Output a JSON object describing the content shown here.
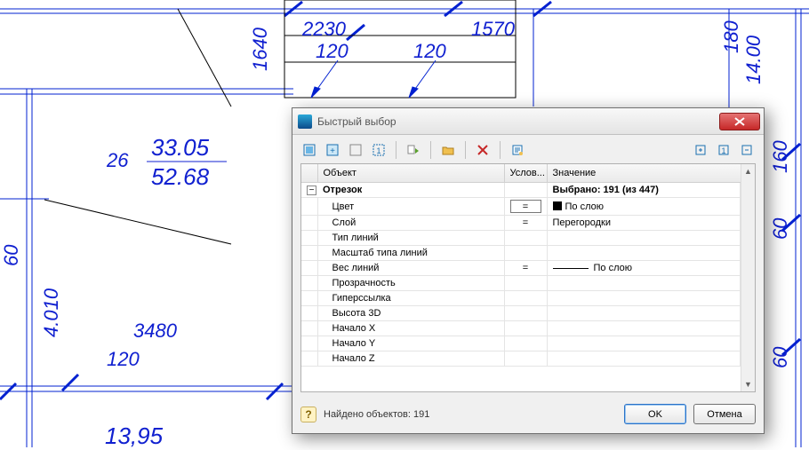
{
  "dialog": {
    "title": "Быстрый выбор",
    "headers": {
      "object": "Объект",
      "condition": "Услов...",
      "value": "Значение"
    },
    "group": {
      "name": "Отрезок",
      "summary": "Выбрано: 191 (из 447)"
    },
    "rows": [
      {
        "prop": "Цвет",
        "cond": "=",
        "value": "По слою",
        "swatch": true
      },
      {
        "prop": "Слой",
        "cond": "=",
        "value": "Перегородки"
      },
      {
        "prop": "Тип линий",
        "cond": "",
        "value": ""
      },
      {
        "prop": "Масштаб типа линий",
        "cond": "",
        "value": ""
      },
      {
        "prop": "Вес линий",
        "cond": "=",
        "value": "По слою",
        "lineweight": true
      },
      {
        "prop": "Прозрачность",
        "cond": "",
        "value": ""
      },
      {
        "prop": "Гиперссылка",
        "cond": "",
        "value": ""
      },
      {
        "prop": "Высота 3D",
        "cond": "",
        "value": ""
      },
      {
        "prop": "Начало X",
        "cond": "",
        "value": ""
      },
      {
        "prop": "Начало Y",
        "cond": "",
        "value": ""
      },
      {
        "prop": "Начало Z",
        "cond": "",
        "value": ""
      }
    ],
    "status": "Найдено объектов: 191",
    "ok": "OK",
    "cancel": "Отмена"
  },
  "cad": {
    "dims": {
      "d2230": "2230",
      "d1570": "1570",
      "d1640": "1640",
      "d120a": "120",
      "d120b": "120",
      "d120c": "120",
      "d180": "180",
      "d14_00": "14.00",
      "d160": "160",
      "d60a": "60",
      "d60b": "60",
      "d60c": "60",
      "d26": "26",
      "d33_05": "33.05",
      "d52_68": "52.68",
      "d4010": "4.010",
      "d3480": "3480",
      "d13_95": "13,95"
    }
  }
}
